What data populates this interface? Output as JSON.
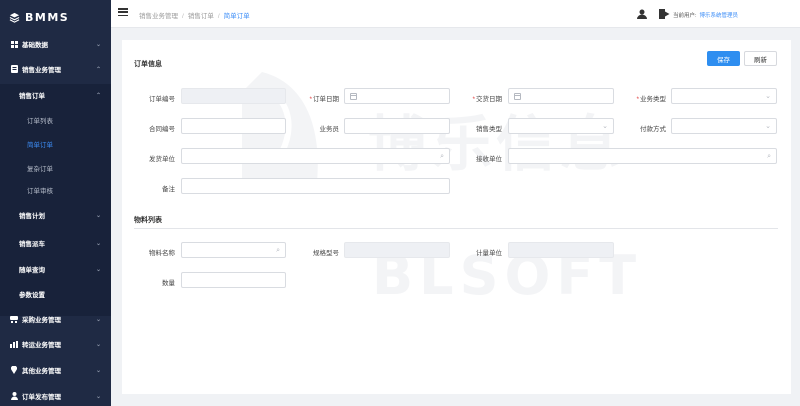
{
  "app": {
    "logo_text": "BMMS"
  },
  "sidebar": {
    "menus": [
      {
        "label": "基础数据",
        "icon": "grid-icon"
      },
      {
        "label": "销售业务管理",
        "icon": "doc-icon"
      },
      {
        "label": "销售计划"
      },
      {
        "label": "销售派车"
      },
      {
        "label": "随单查询"
      },
      {
        "label": "参数设置"
      },
      {
        "label": "采购业务管理",
        "icon": "cart-icon"
      },
      {
        "label": "转运业务管理",
        "icon": "chart-icon"
      },
      {
        "label": "其他业务管理",
        "icon": "pin-icon"
      },
      {
        "label": "订单发布管理",
        "icon": "user-icon"
      }
    ],
    "sales_order": {
      "label": "销售订单",
      "children": [
        "订单列表",
        "简单订单",
        "复杂订单",
        "订单审核"
      ]
    }
  },
  "header": {
    "breadcrumb": [
      "销售业务管理",
      "销售订单",
      "简单订单"
    ],
    "user_label": "当前用户:",
    "user_name": "博乐系统管理员"
  },
  "form": {
    "section_title": "订单信息",
    "save_label": "保存",
    "refresh_label": "刷新",
    "fields": {
      "order_no": "订单编号",
      "order_date": "订单日期",
      "delivery_date": "交货日期",
      "business_type": "业务类型",
      "contract_no": "合同编号",
      "salesman": "业务员",
      "sales_type": "销售类型",
      "payment_method": "付款方式",
      "shipper": "发货单位",
      "receiver": "接收单位",
      "remark": "备注"
    }
  },
  "materials": {
    "section_title": "物料列表",
    "fields": {
      "material_name": "物料名称",
      "spec": "规格型号",
      "unit": "计量单位",
      "quantity": "数量"
    }
  },
  "watermark": {
    "text_cn": "博乐信息",
    "text_en": "BLSOFT"
  },
  "colors": {
    "sidebar_bg": "#1f2a44",
    "accent": "#2e8ef0",
    "required": "#e03a3a"
  }
}
